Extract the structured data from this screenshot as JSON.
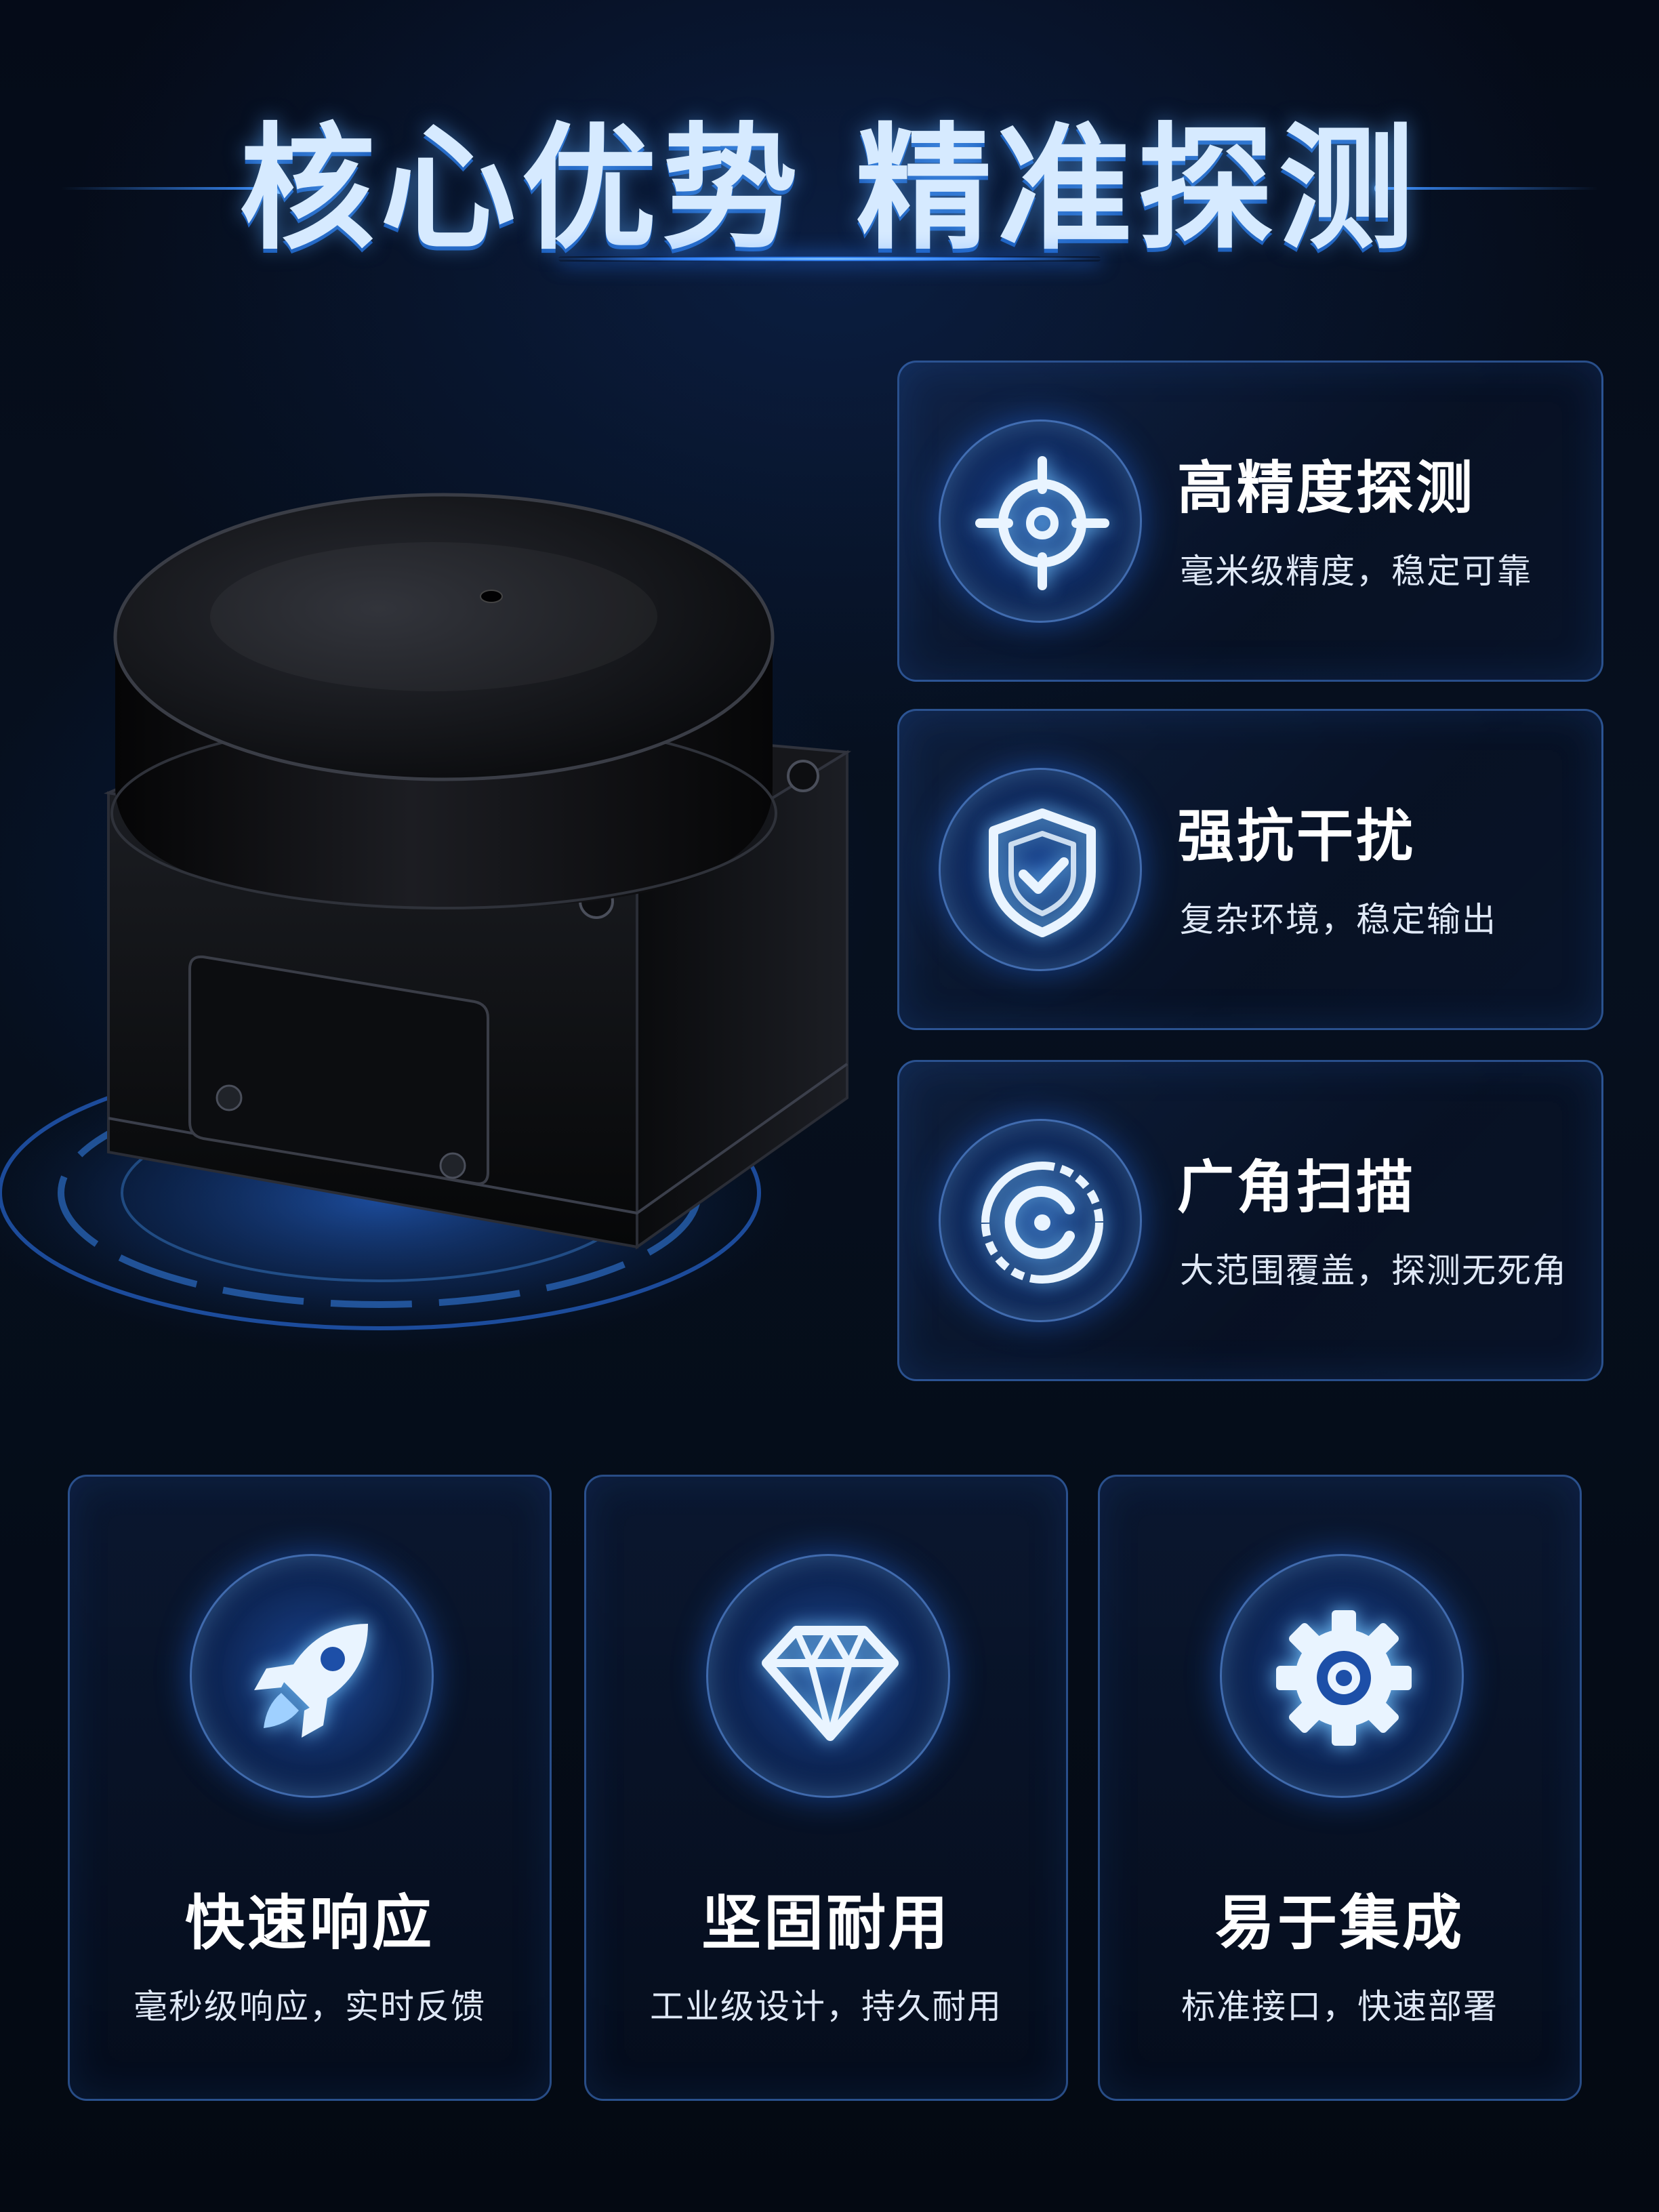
{
  "header": {
    "title": "核心优势 精准探测"
  },
  "features": [
    {
      "title": "高精度探测",
      "desc": "毫米级精度，稳定可靠",
      "icon": "crosshair-target-icon"
    },
    {
      "title": "强抗干扰",
      "desc": "复杂环境，稳定输出",
      "icon": "shield-check-icon"
    },
    {
      "title": "广角扫描",
      "desc": "大范围覆盖，探测无死角",
      "icon": "scan-circle-icon"
    }
  ],
  "benefits": [
    {
      "title": "快速响应",
      "desc": "毫秒级响应，实时反馈",
      "icon": "rocket-icon"
    },
    {
      "title": "坚固耐用",
      "desc": "工业级设计，持久耐用",
      "icon": "diamond-icon"
    },
    {
      "title": "易于集成",
      "desc": "标准接口，快速部署",
      "icon": "gear-icon"
    }
  ],
  "colors": {
    "background": "#050b18",
    "accent": "#3a8eff",
    "card_border": "#4682dc",
    "title_text": "#d6eaff",
    "body_text": "#dfe8f6"
  }
}
